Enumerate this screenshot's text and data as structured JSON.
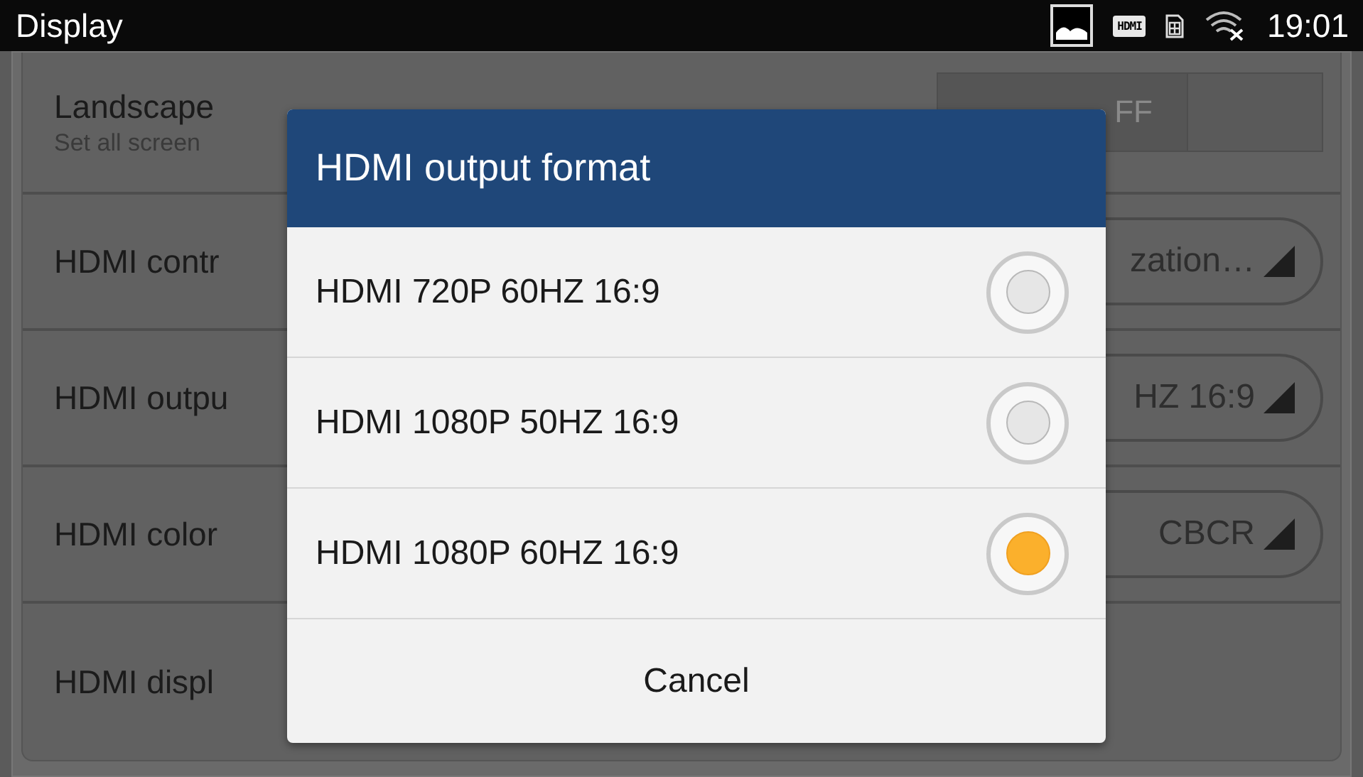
{
  "status_bar": {
    "title": "Display",
    "hdmi_badge": "HDMI",
    "time": "19:01"
  },
  "settings": [
    {
      "kind": "switch",
      "label": "Landscape",
      "subtitle": "Set all screen",
      "value": "FF",
      "on": false
    },
    {
      "kind": "dropdown",
      "label": "HDMI contr",
      "value": "zation…"
    },
    {
      "kind": "dropdown",
      "label": "HDMI outpu",
      "value": "HZ 16:9"
    },
    {
      "kind": "dropdown",
      "label": "HDMI color",
      "value": "CBCR"
    },
    {
      "kind": "plain",
      "label": "HDMI displ"
    }
  ],
  "dialog": {
    "title": "HDMI output format",
    "options": [
      {
        "label": "HDMI 720P 60HZ 16:9",
        "selected": false
      },
      {
        "label": "HDMI 1080P 50HZ 16:9",
        "selected": false
      },
      {
        "label": "HDMI 1080P 60HZ 16:9",
        "selected": true
      }
    ],
    "cancel": "Cancel"
  }
}
